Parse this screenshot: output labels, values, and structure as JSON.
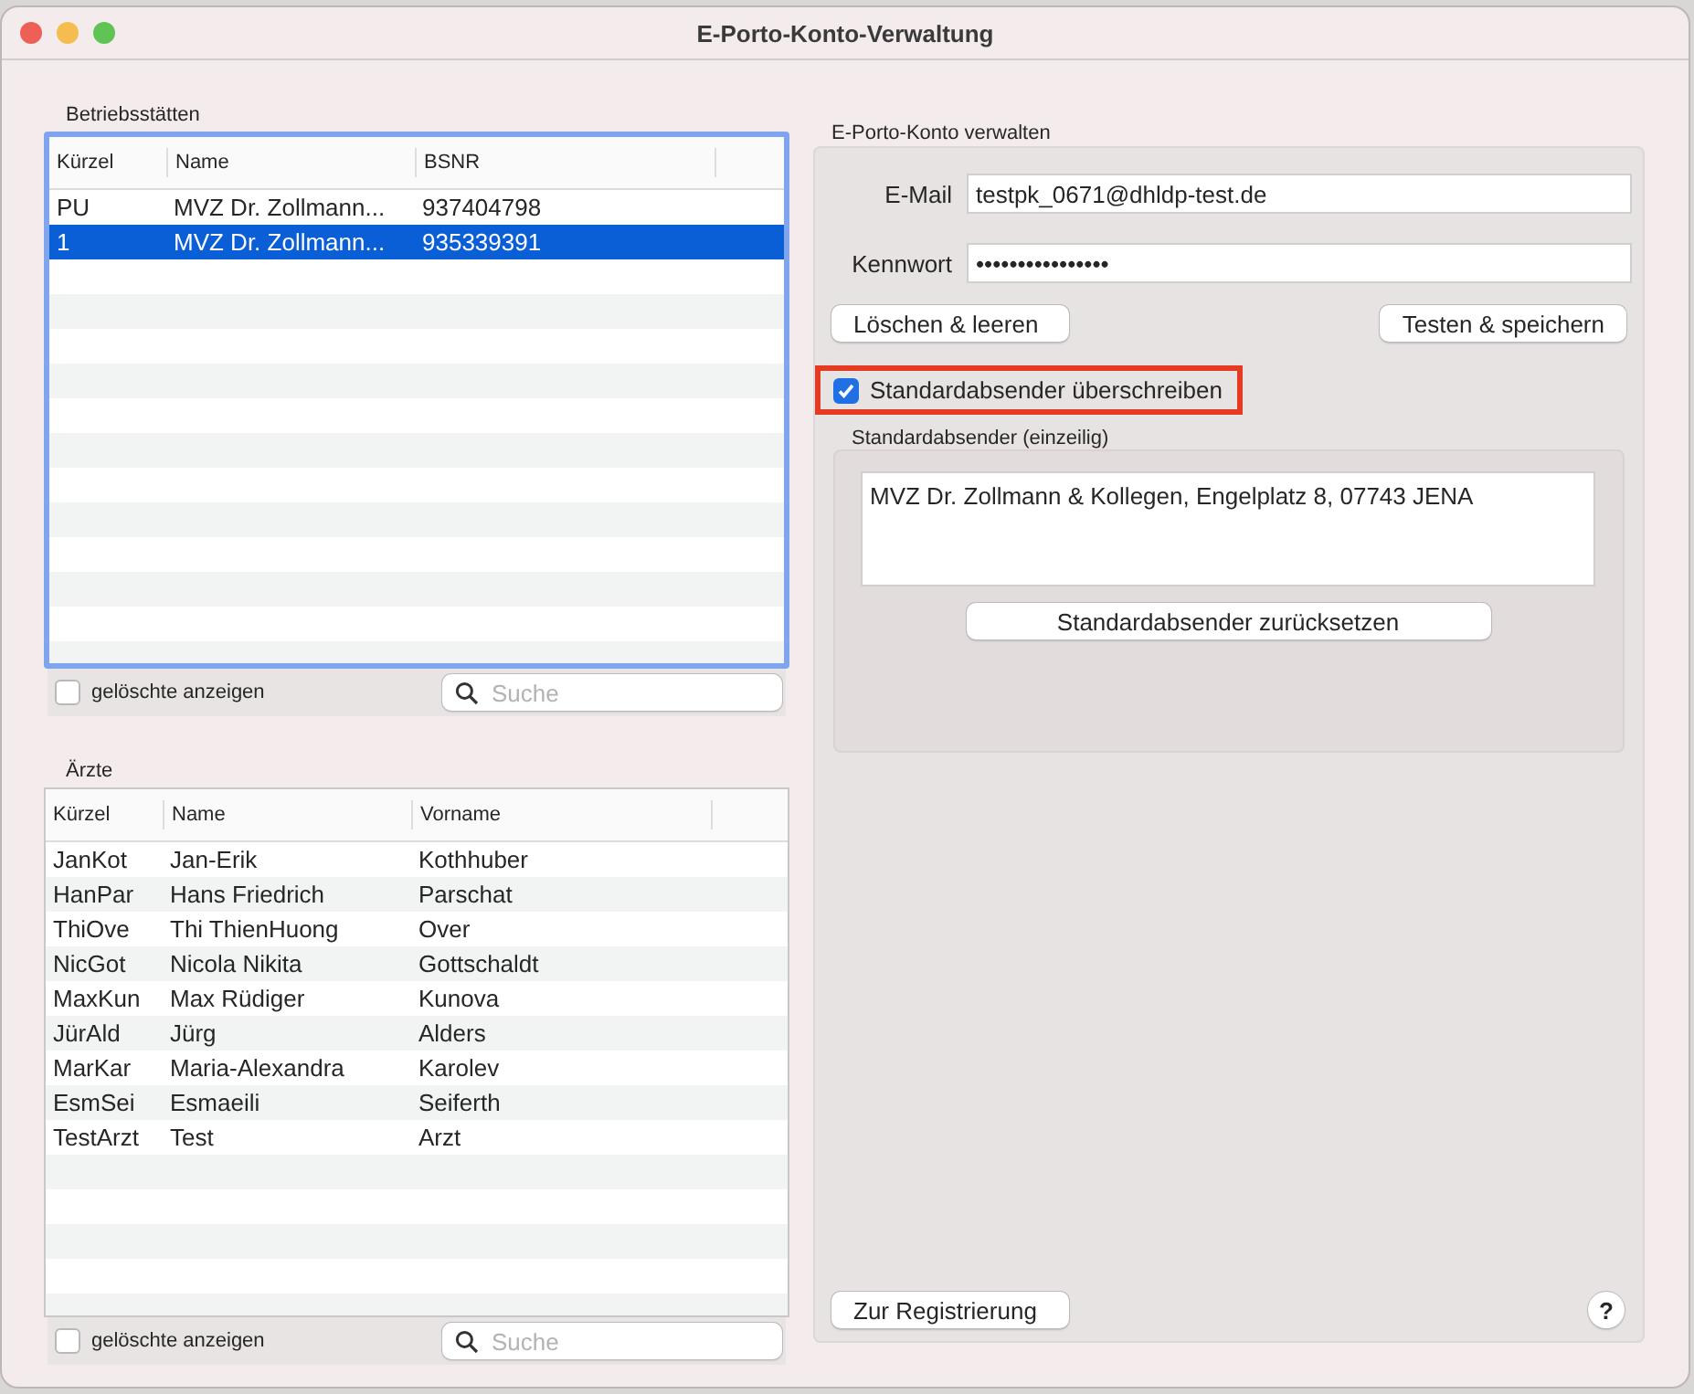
{
  "window": {
    "title": "E-Porto-Konto-Verwaltung"
  },
  "betriebsstaetten": {
    "label": "Betriebsstätten",
    "focused": true,
    "columns": [
      "Kürzel",
      "Name",
      "BSNR"
    ],
    "rows": [
      {
        "cells": [
          "PU",
          "MVZ Dr. Zollmann...",
          "937404798"
        ],
        "selected": false
      },
      {
        "cells": [
          "1",
          "MVZ Dr. Zollmann...",
          "935339391"
        ],
        "selected": true
      }
    ],
    "show_deleted": {
      "label": "gelöschte anzeigen",
      "checked": false
    },
    "search": {
      "placeholder": "Suche"
    }
  },
  "aerzte": {
    "label": "Ärzte",
    "focused": false,
    "columns": [
      "Kürzel",
      "Name",
      "Vorname"
    ],
    "rows": [
      {
        "cells": [
          "JanKot",
          "Jan-Erik",
          "Kothhuber"
        ],
        "selected": false
      },
      {
        "cells": [
          "HanPar",
          "Hans Friedrich",
          "Parschat"
        ],
        "selected": false
      },
      {
        "cells": [
          "ThiOve",
          "Thi ThienHuong",
          "Over"
        ],
        "selected": false
      },
      {
        "cells": [
          "NicGot",
          "Nicola Nikita",
          "Gottschaldt"
        ],
        "selected": false
      },
      {
        "cells": [
          "MaxKun",
          "Max Rüdiger",
          "Kunova"
        ],
        "selected": false
      },
      {
        "cells": [
          "JürAld",
          "Jürg",
          "Alders"
        ],
        "selected": false
      },
      {
        "cells": [
          "MarKar",
          "Maria-Alexandra",
          "Karolev"
        ],
        "selected": false
      },
      {
        "cells": [
          "EsmSei",
          "Esmaeili",
          "Seiferth"
        ],
        "selected": false
      },
      {
        "cells": [
          "TestArzt",
          "Test",
          "Arzt"
        ],
        "selected": false
      }
    ],
    "show_deleted": {
      "label": "gelöschte anzeigen",
      "checked": false
    },
    "search": {
      "placeholder": "Suche"
    }
  },
  "account": {
    "label": "E-Porto-Konto verwalten",
    "email": {
      "label": "E-Mail",
      "value": "testpk_0671@dhldp-test.de"
    },
    "password": {
      "label": "Kennwort",
      "value": "••••••••••••••••"
    },
    "clear_button": "Löschen & leeren",
    "save_button": "Testen & speichern",
    "override": {
      "label": "Standardabsender überschreiben",
      "checked": true,
      "highlighted": true
    },
    "sender": {
      "label": "Standardabsender (einzeilig)",
      "value": "MVZ Dr. Zollmann & Kollegen, Engelplatz 8, 07743 JENA",
      "reset_button": "Standardabsender zurücksetzen"
    },
    "register_button": "Zur Registrierung",
    "help_button": "?"
  }
}
